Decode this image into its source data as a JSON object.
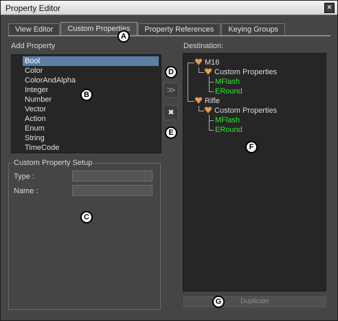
{
  "window": {
    "title": "Property Editor",
    "close_glyph": "×"
  },
  "tabs": [
    {
      "label": "View Editor",
      "active": false
    },
    {
      "label": "Custom Properties",
      "active": true
    },
    {
      "label": "Property References",
      "active": false
    },
    {
      "label": "Keying Groups",
      "active": false
    }
  ],
  "add_property": {
    "label": "Add Property",
    "items": [
      "Bool",
      "Color",
      "ColorAndAlpha",
      "Integer",
      "Number",
      "Vector",
      "Action",
      "Enum",
      "String",
      "TimeCode"
    ],
    "selected": "Bool"
  },
  "setup": {
    "title": "Custom Property Setup",
    "type_label": "Type :",
    "name_label": "Name :",
    "type_value": "",
    "name_value": ""
  },
  "buttons": {
    "add_glyph": "≫",
    "remove_glyph": "✖",
    "duplicate_label": "Duplicate"
  },
  "destination": {
    "label": "Destination:",
    "tree": [
      {
        "name": "M16",
        "group": "Custom Properties",
        "props": [
          "MFlash",
          "ERound"
        ]
      },
      {
        "name": "Rifle",
        "group": "Custom Properties",
        "props": [
          "MFlash",
          "ERound"
        ]
      }
    ]
  },
  "markers": [
    "A",
    "B",
    "C",
    "D",
    "E",
    "F",
    "G"
  ],
  "colors": {
    "selection": "#5d7fa6",
    "property_text": "#2bea2b",
    "panel": "#262626",
    "background": "#454545"
  },
  "icons": {
    "object": "object-heart-icon",
    "group": "custom-properties-icon"
  }
}
